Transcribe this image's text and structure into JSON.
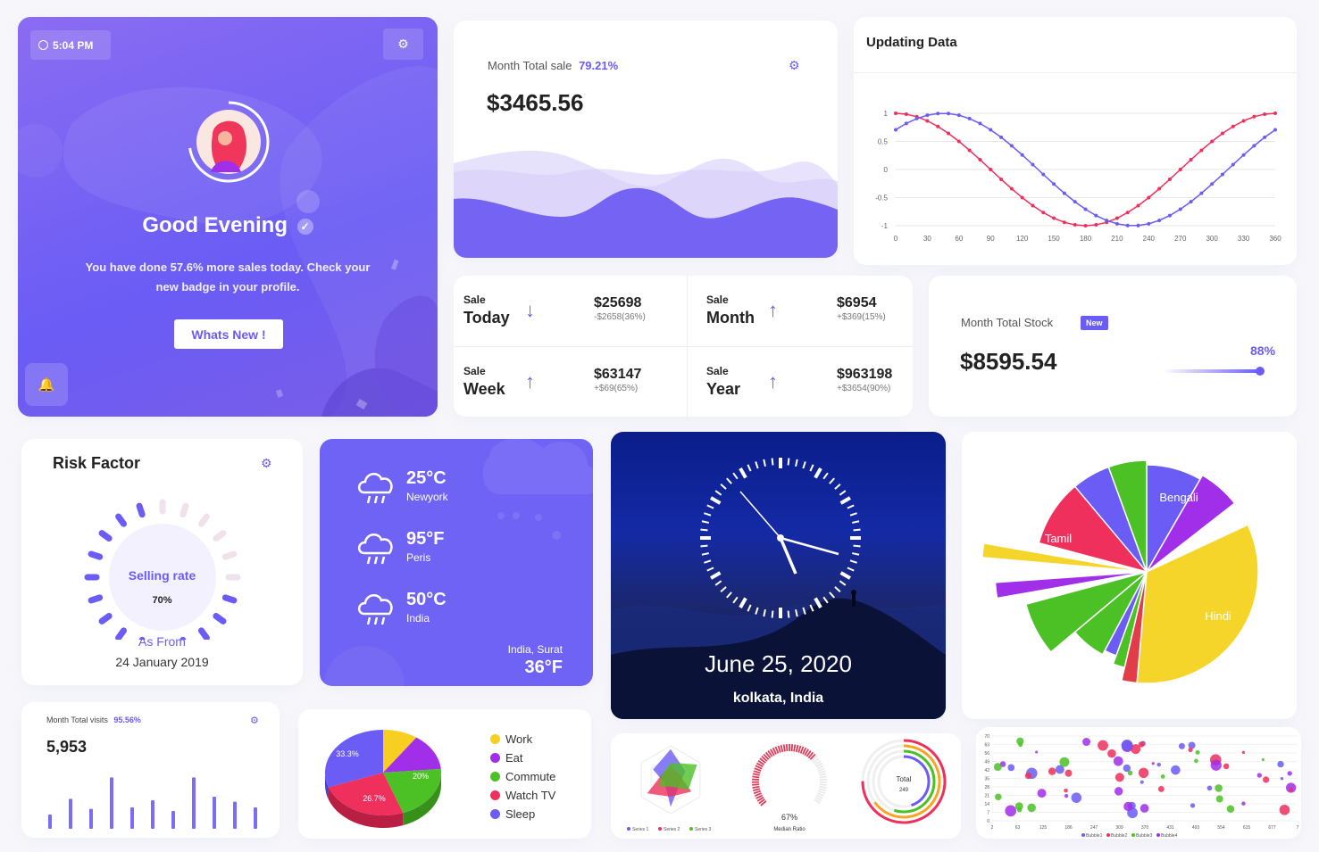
{
  "welcome": {
    "time": "5:04 PM",
    "greeting": "Good Evening",
    "message_line1": "You have done 57.6% more sales today. Check your",
    "message_line2": "new badge in your profile.",
    "button": "Whats New !"
  },
  "month_sale": {
    "label": "Month Total sale",
    "percent": "79.21%",
    "amount": "$3465.56"
  },
  "updating_data": {
    "title": "Updating Data",
    "y_ticks": [
      "1",
      "0.5",
      "0",
      "-0.5",
      "-1"
    ],
    "x_ticks": [
      "0",
      "30",
      "60",
      "90",
      "120",
      "150",
      "180",
      "210",
      "240",
      "270",
      "300",
      "330",
      "360"
    ]
  },
  "sales": [
    {
      "small": "Sale",
      "period": "Today",
      "value": "$25698",
      "delta": "-$2658(36%)",
      "dir": "down"
    },
    {
      "small": "Sale",
      "period": "Month",
      "value": "$6954",
      "delta": "+$369(15%)",
      "dir": "up"
    },
    {
      "small": "Sale",
      "period": "Week",
      "value": "$63147",
      "delta": "+$69(65%)",
      "dir": "up"
    },
    {
      "small": "Sale",
      "period": "Year",
      "value": "$963198",
      "delta": "+$3654(90%)",
      "dir": "up"
    }
  ],
  "stock": {
    "label": "Month Total Stock",
    "badge": "New",
    "amount": "$8595.54",
    "percent": "88%",
    "progress": 0.88
  },
  "risk": {
    "title": "Risk Factor",
    "center_label": "Selling rate",
    "center_value": "70%",
    "from_label": "As From",
    "date": "24 January 2019",
    "progress": 0.7
  },
  "weather": {
    "items": [
      {
        "temp": "25°C",
        "city": "Newyork"
      },
      {
        "temp": "95°F",
        "city": "Peris"
      },
      {
        "temp": "50°C",
        "city": "India"
      }
    ],
    "location": "India, Surat",
    "location_temp": "36°F"
  },
  "clock": {
    "date": "June 25, 2020",
    "place": "kolkata, India"
  },
  "language_pie": {
    "labels": [
      "Bengali",
      "Tamil",
      "Hindi"
    ]
  },
  "visits": {
    "label": "Month Total visits",
    "percent": "95.56%",
    "value": "5,953",
    "bars": [
      0.2,
      0.42,
      0.28,
      0.72,
      0.3,
      0.4,
      0.25,
      0.72,
      0.45,
      0.38,
      0.3
    ]
  },
  "activity_pie": {
    "labels": [
      "33.3%",
      "20%",
      "26.7%"
    ],
    "legend": [
      {
        "name": "Work",
        "color": "#f6cf21"
      },
      {
        "name": "Eat",
        "color": "#a12ee8"
      },
      {
        "name": "Commute",
        "color": "#4cc126"
      },
      {
        "name": "Watch TV",
        "color": "#ef2f5c"
      },
      {
        "name": "Sleep",
        "color": "#6a5cf5"
      }
    ]
  },
  "mini_charts": {
    "radar_legend": [
      "Series 1",
      "Series 2",
      "Series 3"
    ],
    "gauge_value": "67%",
    "gauge_label": "Median Ratio",
    "radial_label": "Total",
    "radial_value": "249"
  },
  "bubble": {
    "y_ticks": [
      "70",
      "63",
      "56",
      "49",
      "42",
      "35",
      "28",
      "21",
      "14",
      "7",
      "0"
    ],
    "x_ticks": [
      "2",
      "63",
      "125",
      "186",
      "247",
      "309",
      "370",
      "431",
      "493",
      "554",
      "615",
      "677",
      "7"
    ],
    "legend": [
      "Bubble1",
      "Bubble2",
      "Bubble3",
      "Bubble4"
    ]
  }
}
